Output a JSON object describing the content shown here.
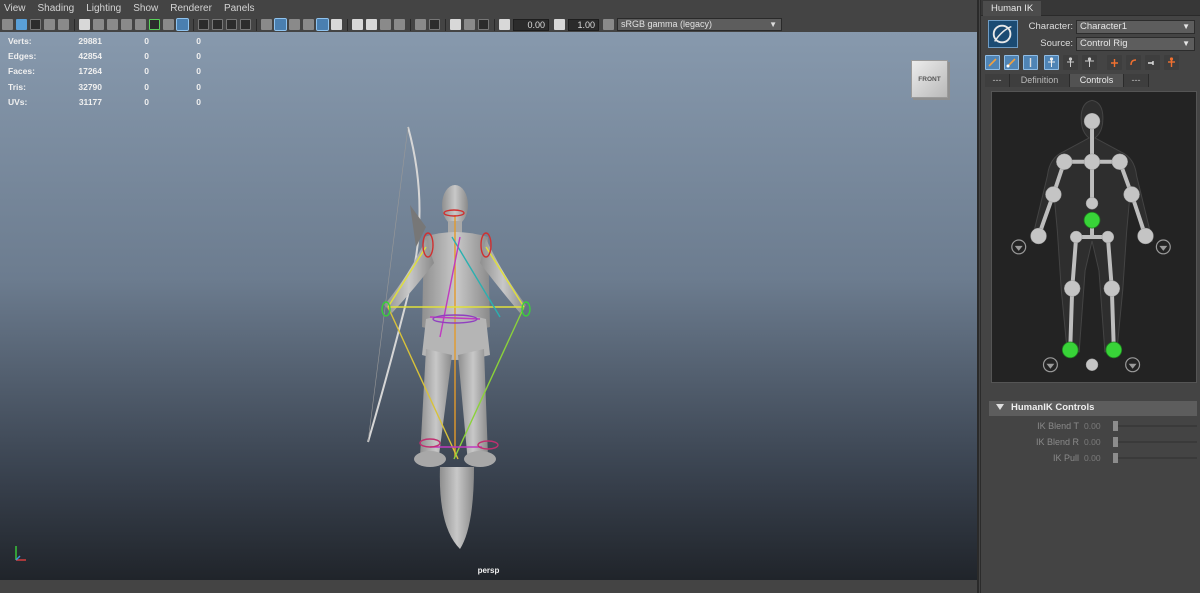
{
  "menubar": {
    "items": [
      "View",
      "Shading",
      "Lighting",
      "Show",
      "Renderer",
      "Panels"
    ]
  },
  "toolbar": {
    "exposure_value": "0.00",
    "gamma_value": "1.00",
    "color_space": "sRGB gamma (legacy)"
  },
  "hud": {
    "rows": [
      {
        "label": "Verts:",
        "v1": "29881",
        "v2": "0",
        "v3": "0"
      },
      {
        "label": "Edges:",
        "v1": "42854",
        "v2": "0",
        "v3": "0"
      },
      {
        "label": "Faces:",
        "v1": "17264",
        "v2": "0",
        "v3": "0"
      },
      {
        "label": "Tris:",
        "v1": "32790",
        "v2": "0",
        "v3": "0"
      },
      {
        "label": "UVs:",
        "v1": "31177",
        "v2": "0",
        "v3": "0"
      }
    ]
  },
  "viewport": {
    "view_cube_label": "FRONT",
    "camera_name": "persp"
  },
  "hik": {
    "panel_tab": "Human IK",
    "character_label": "Character:",
    "character_value": "Character1",
    "source_label": "Source:",
    "source_value": "Control Rig",
    "subtabs": [
      "---",
      "Definition",
      "Controls",
      "---"
    ],
    "active_subtab": "Controls",
    "controls_section_title": "HumanIK Controls",
    "blend_rows": [
      {
        "label": "IK Blend T",
        "value": "0.00",
        "fraction": 0.0
      },
      {
        "label": "IK Blend R",
        "value": "0.00",
        "fraction": 0.0
      },
      {
        "label": "IK Pull",
        "value": "0.00",
        "fraction": 0.0
      }
    ],
    "colors": {
      "selected_effector": "#38d338",
      "joint": "#bdbdbd",
      "accent": "#4f84b5"
    }
  }
}
